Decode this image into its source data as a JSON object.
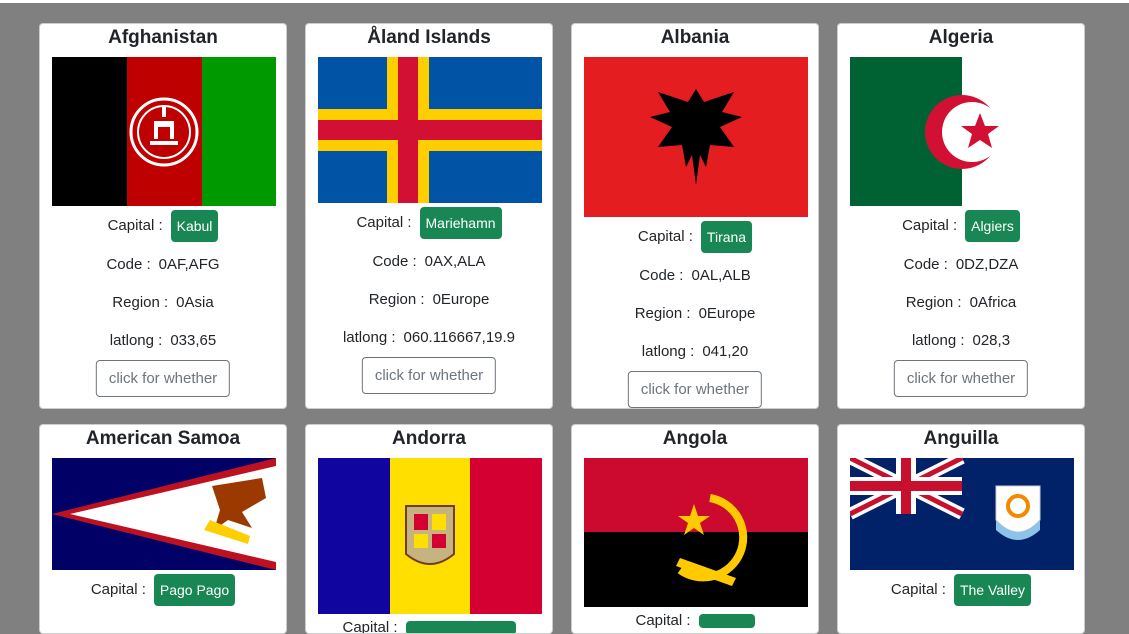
{
  "countries": [
    {
      "name": "Afghanistan",
      "capital": "Kabul",
      "code": "0AF,AFG",
      "region": "0Asia",
      "latlong": "033,65"
    },
    {
      "name": "Åland Islands",
      "capital": "Mariehamn",
      "code": "0AX,ALA",
      "region": "0Europe",
      "latlong": "060.116667,19.9"
    },
    {
      "name": "Albania",
      "capital": "Tirana",
      "code": "0AL,ALB",
      "region": "0Europe",
      "latlong": "041,20"
    },
    {
      "name": "Algeria",
      "capital": "Algiers",
      "code": "0DZ,DZA",
      "region": "0Africa",
      "latlong": "028,3"
    },
    {
      "name": "American Samoa",
      "capital": "Pago Pago"
    },
    {
      "name": "Andorra",
      "capital": ""
    },
    {
      "name": "Angola",
      "capital": ""
    },
    {
      "name": "Anguilla",
      "capital": "The Valley"
    }
  ],
  "labels": {
    "capital": "Capital :",
    "code": "Code :",
    "region": "Region :",
    "latlong": "latlong :",
    "button": "click for whether"
  },
  "colors": {
    "page_bg": "#808080",
    "badge": "#198754",
    "button_border": "#6c757d"
  }
}
